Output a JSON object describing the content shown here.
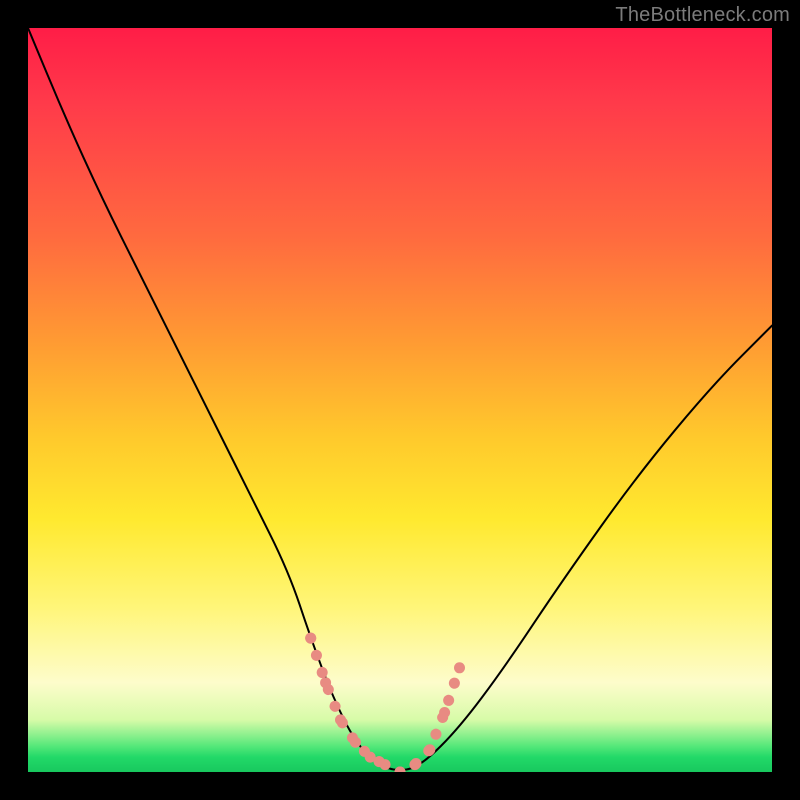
{
  "watermark": {
    "text": "TheBottleneck.com"
  },
  "chart_data": {
    "type": "line",
    "title": "",
    "xlabel": "",
    "ylabel": "",
    "xlim": [
      0,
      100
    ],
    "ylim": [
      0,
      100
    ],
    "grid": false,
    "legend": false,
    "background_gradient": {
      "top_color": "#ff1d47",
      "mid_color": "#ffe92f",
      "bottom_color": "#18c85e"
    },
    "series": [
      {
        "name": "bottleneck-curve",
        "color": "#000000",
        "stroke_width": 2,
        "x": [
          0,
          5,
          10,
          15,
          20,
          25,
          30,
          35,
          38,
          41,
          44,
          47,
          50,
          53,
          58,
          64,
          72,
          82,
          92,
          100
        ],
        "y": [
          100,
          88,
          77,
          67,
          57,
          47,
          37,
          27,
          18,
          10,
          4,
          1,
          0,
          1,
          6,
          14,
          26,
          40,
          52,
          60
        ]
      },
      {
        "name": "highlight-zone-left",
        "color": "#e88b82",
        "stroke_width": 11,
        "style": "dotted",
        "x": [
          38,
          40,
          42,
          44,
          46,
          48
        ],
        "y": [
          18,
          12,
          7,
          4,
          2,
          1
        ]
      },
      {
        "name": "highlight-zone-right",
        "color": "#e88b82",
        "stroke_width": 11,
        "style": "dotted",
        "x": [
          50,
          52,
          54,
          56,
          58
        ],
        "y": [
          0,
          1,
          3,
          8,
          14
        ]
      }
    ],
    "annotations": []
  }
}
